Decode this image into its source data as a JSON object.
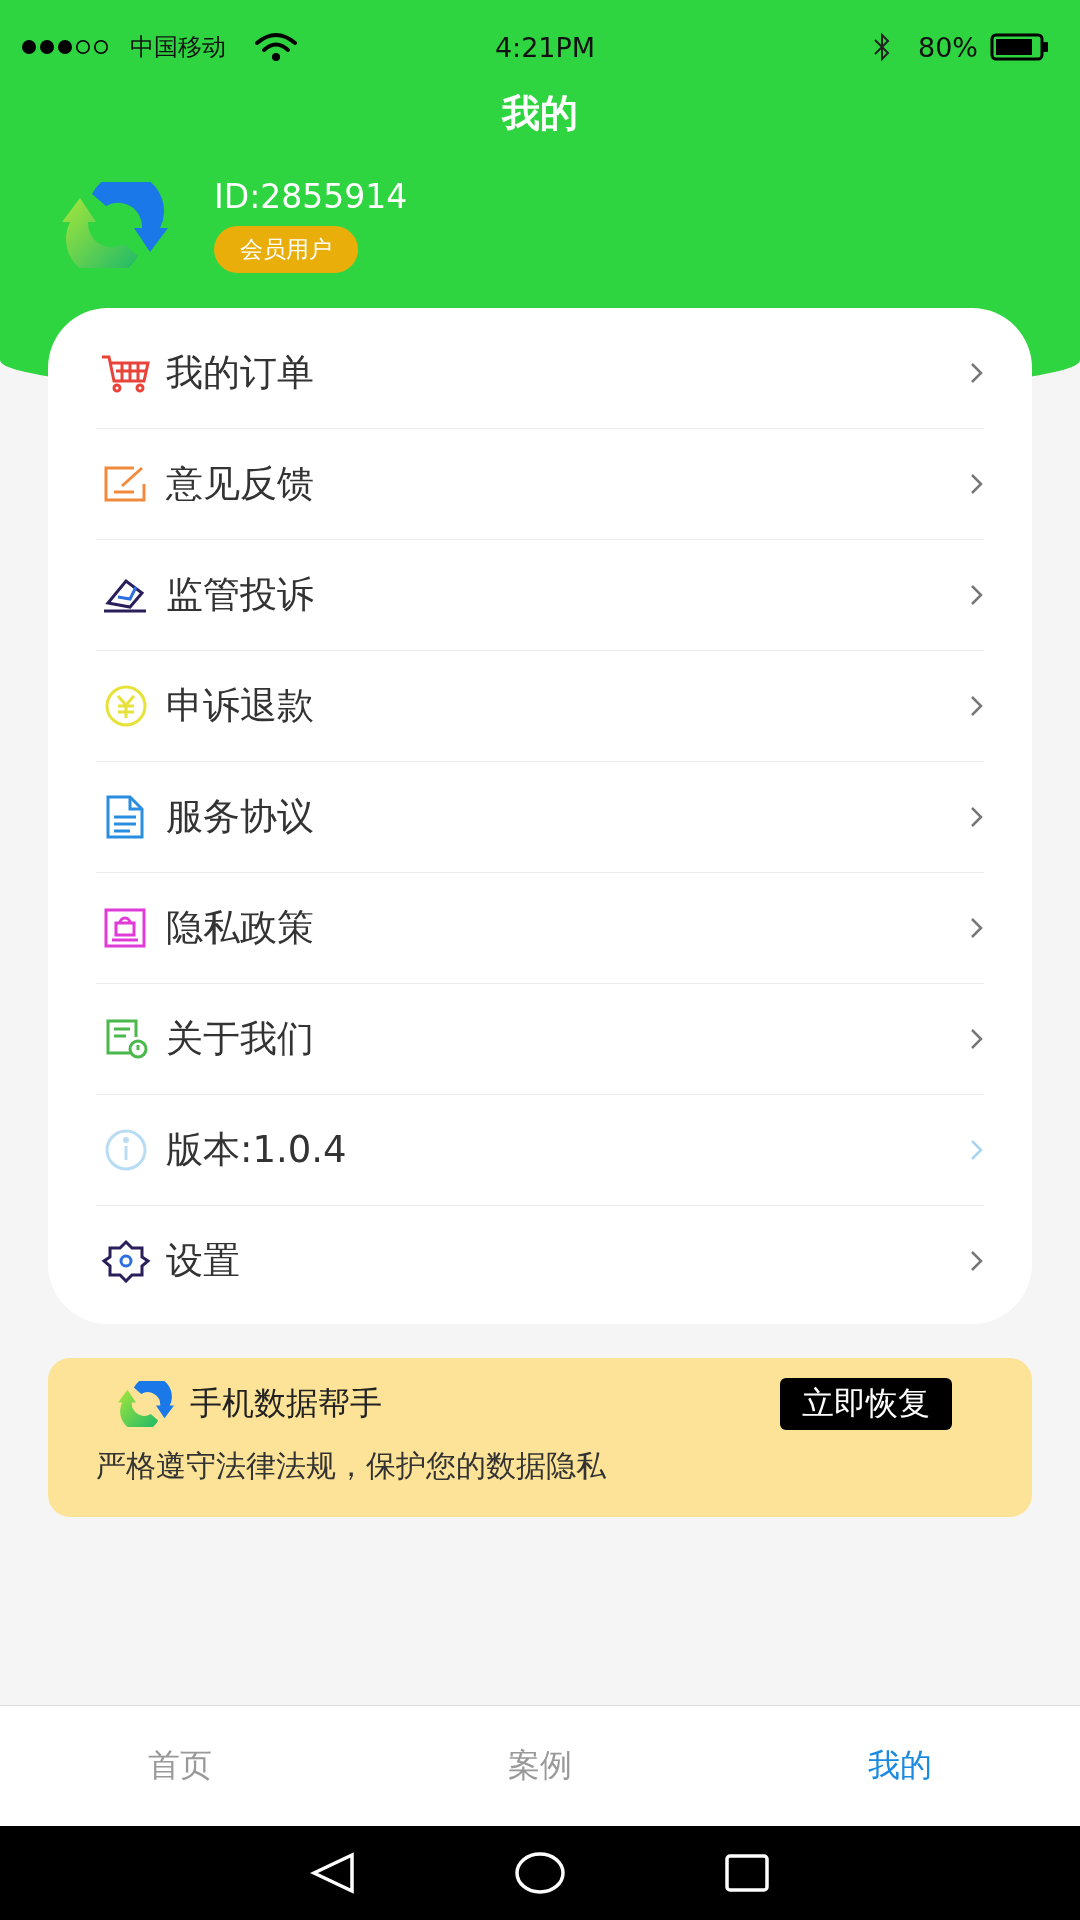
{
  "status_bar": {
    "carrier": "中国移动",
    "time": "4:21PM",
    "battery": "80%"
  },
  "title": "我的",
  "profile": {
    "id": "ID:2855914",
    "badge": "会员用户"
  },
  "menu": [
    {
      "kind": "cart",
      "label": "我的订单"
    },
    {
      "kind": "feedback",
      "label": "意见反馈"
    },
    {
      "kind": "complaint",
      "label": "监管投诉"
    },
    {
      "kind": "refund",
      "label": "申诉退款"
    },
    {
      "kind": "document",
      "label": "服务协议"
    },
    {
      "kind": "privacy",
      "label": "隐私政策"
    },
    {
      "kind": "about",
      "label": "关于我们"
    },
    {
      "kind": "version",
      "label": "版本:1.0.4"
    },
    {
      "kind": "settings",
      "label": "设置"
    }
  ],
  "promo": {
    "title": "手机数据帮手",
    "button": "立即恢复",
    "text": "严格遵守法律法规，保护您的数据隐私"
  },
  "tabs": [
    {
      "label": "首页",
      "selected": false
    },
    {
      "label": "案例",
      "selected": false
    },
    {
      "label": "我的",
      "selected": true
    }
  ]
}
